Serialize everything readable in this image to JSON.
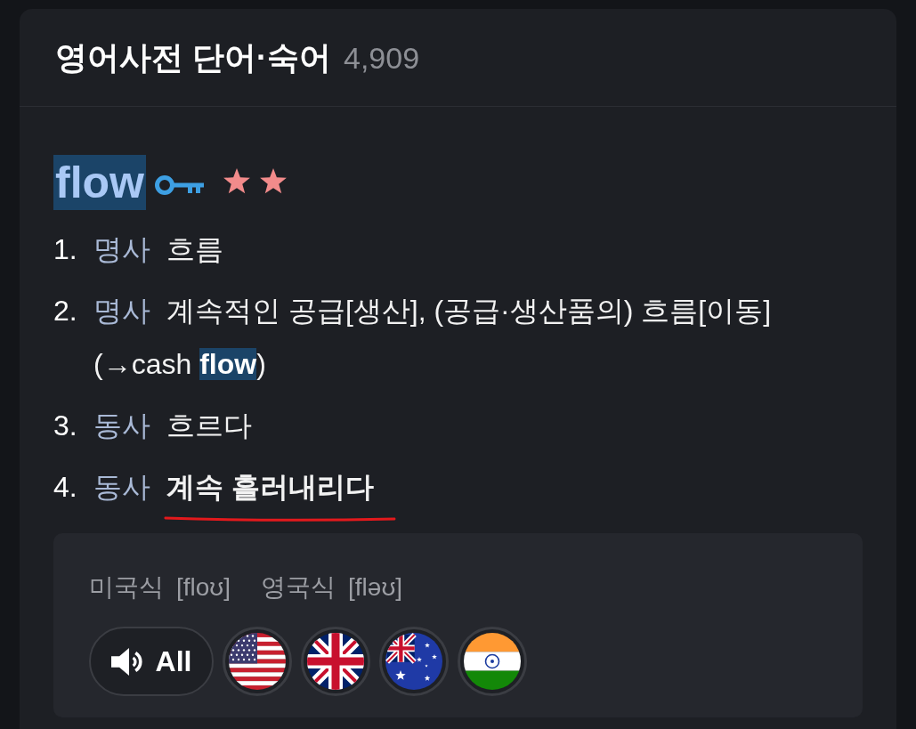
{
  "header": {
    "title": "영어사전 단어·숙어",
    "count": "4,909"
  },
  "entry": {
    "word": "flow",
    "highlighted": true,
    "rating": [
      {
        "filled": true
      },
      {
        "filled": true
      }
    ]
  },
  "senses": [
    {
      "number": "1.",
      "pos": "명사",
      "definition": "흐름",
      "emphasized": false,
      "underlined": false
    },
    {
      "number": "2.",
      "pos": "명사",
      "definition": "계속적인 공급[생산], (공급·생산품의) 흐름[이동]",
      "emphasized": false,
      "underlined": false,
      "cross_ref": [
        {
          "text": "(→cash ",
          "match": false
        },
        {
          "text": "flow",
          "match": true
        },
        {
          "text": ")",
          "match": false
        }
      ]
    },
    {
      "number": "3.",
      "pos": "동사",
      "definition": "흐르다",
      "emphasized": false,
      "underlined": false
    },
    {
      "number": "4.",
      "pos": "동사",
      "definition": "계속 흘러내리다",
      "emphasized": true,
      "underlined": true
    }
  ],
  "pronunciation": {
    "variants": [
      {
        "label": "미국식",
        "ipa": "[floʊ]"
      },
      {
        "label": "영국식",
        "ipa": "[fləʊ]"
      }
    ],
    "buttons": [
      {
        "kind": "all",
        "label": "All"
      },
      {
        "kind": "us"
      },
      {
        "kind": "uk"
      },
      {
        "kind": "au"
      },
      {
        "kind": "in"
      }
    ]
  }
}
